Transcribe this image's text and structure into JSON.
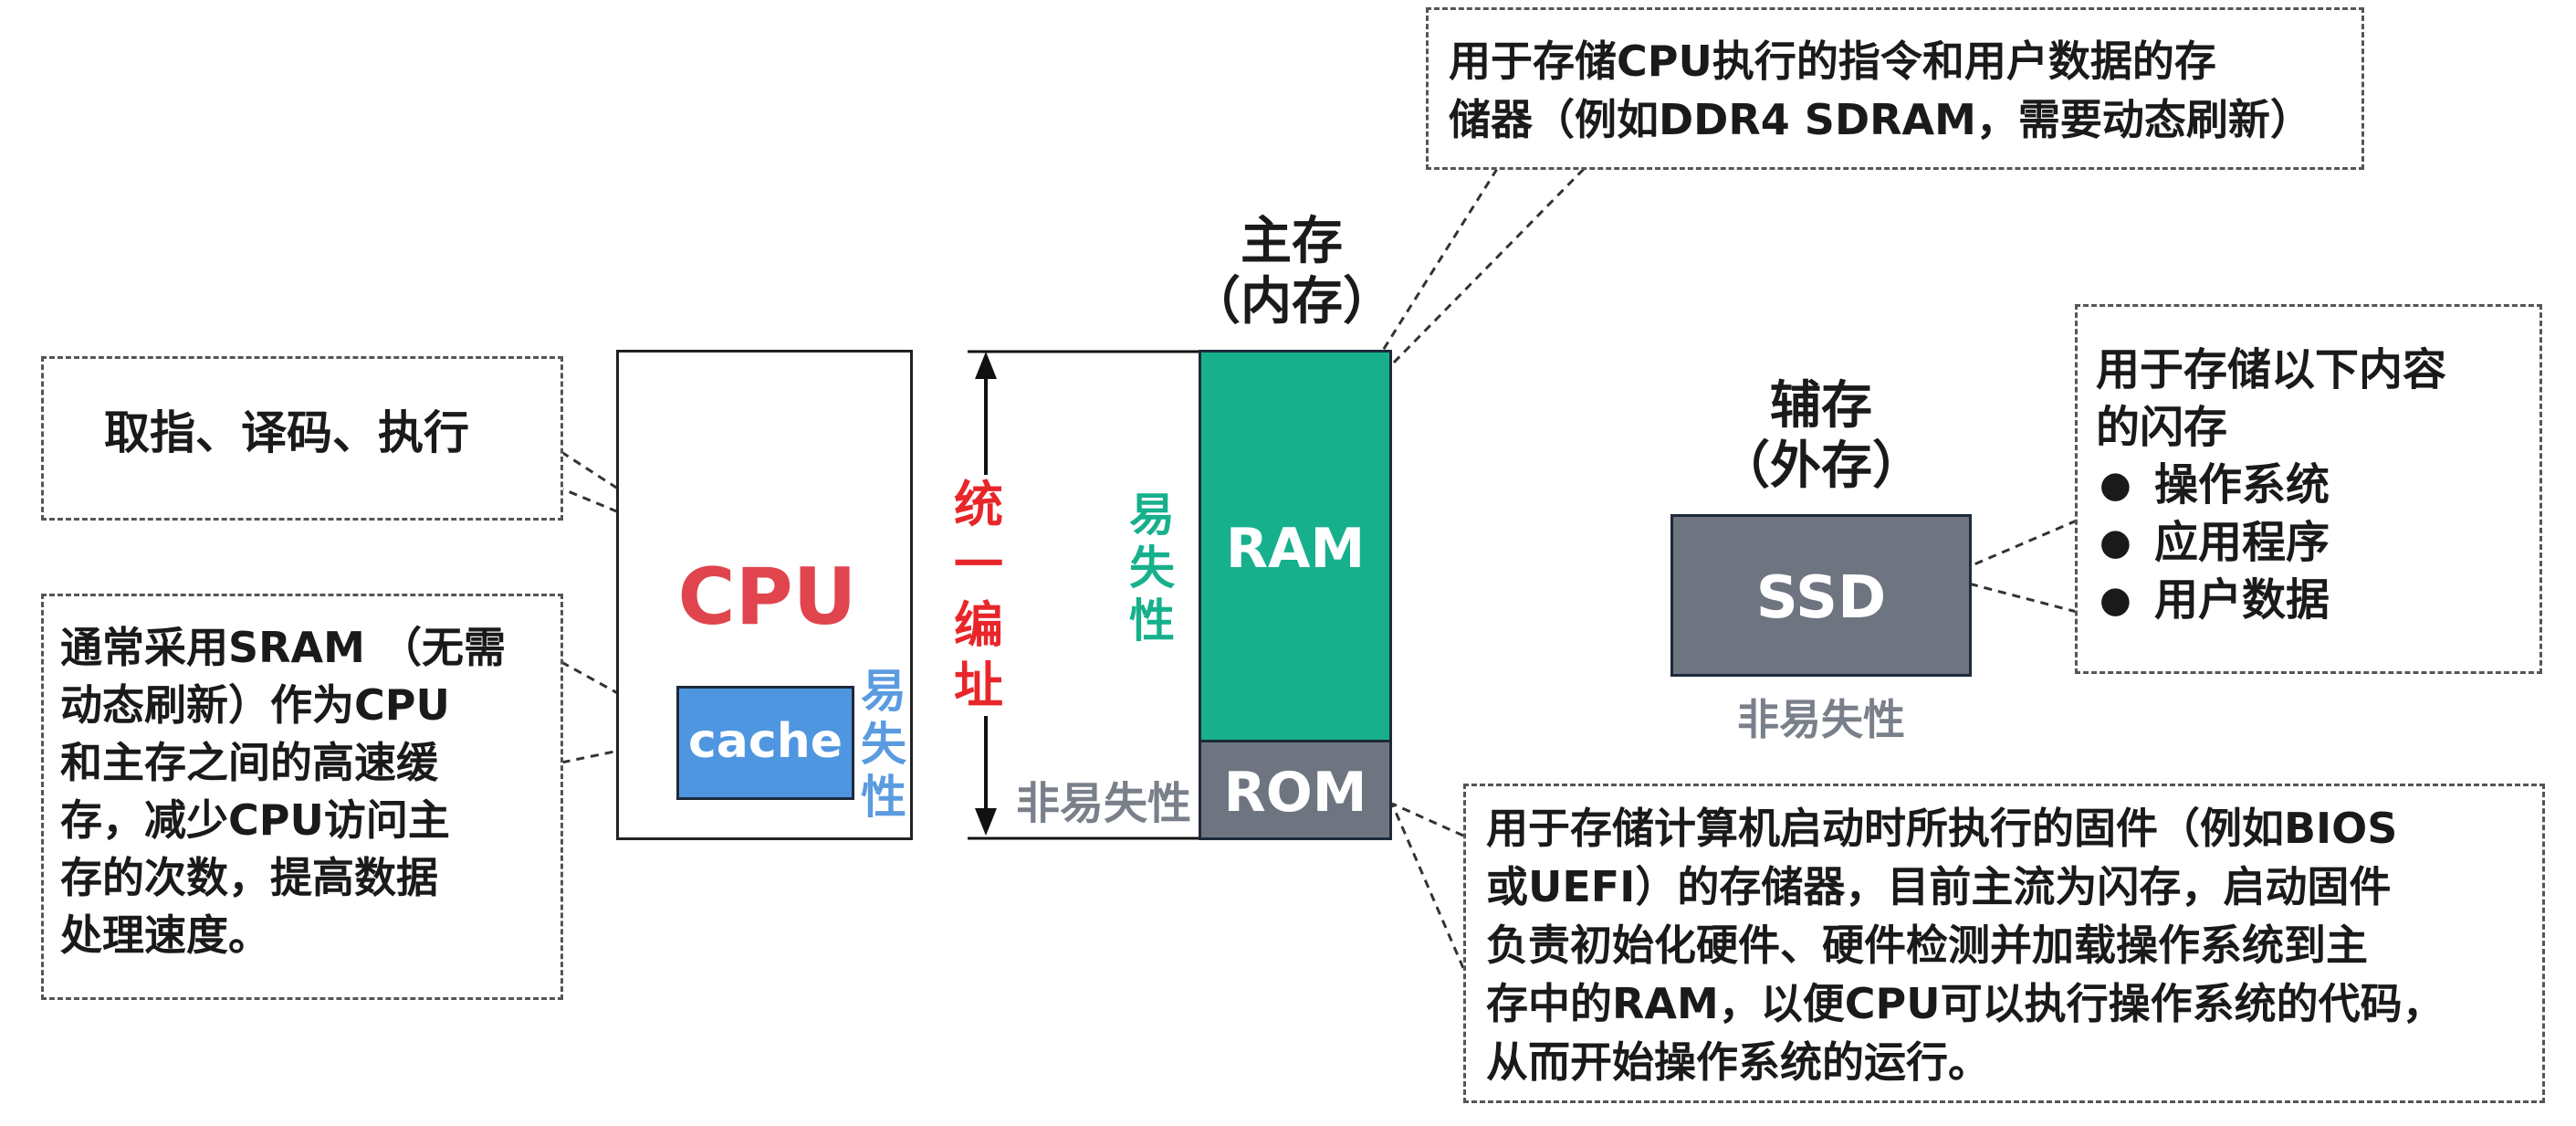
{
  "labels": {
    "cpu": "CPU",
    "cache": "cache",
    "cache_volatile": [
      "易",
      "失",
      "性"
    ],
    "unified_address": [
      "统",
      "一",
      "编",
      "址"
    ],
    "main_memory_title": "主存",
    "main_memory_subtitle": "（内存）",
    "ram": "RAM",
    "ram_volatile": [
      "易",
      "失",
      "性"
    ],
    "rom": "ROM",
    "rom_nonvolatile": "非易失性",
    "secondary_title": "辅存",
    "secondary_subtitle": "（外存）",
    "ssd": "SSD",
    "ssd_nonvolatile": "非易失性"
  },
  "notes": {
    "cpu_note": "取指、译码、执行",
    "cache_note": [
      "通常采用SRAM （无需",
      "动态刷新）作为CPU",
      "和主存之间的高速缓",
      "存，减少CPU访问主",
      "存的次数，提高数据",
      "处理速度。"
    ],
    "ram_note": [
      "用于存储CPU执行的指令和用户数据的存",
      "储器（例如DDR4 SDRAM，需要动态刷新）"
    ],
    "ssd_note_intro": [
      "用于存储以下内容",
      "的闪存"
    ],
    "ssd_note_items": [
      "操作系统",
      "应用程序",
      "用户数据"
    ],
    "rom_note": [
      "用于存储计算机启动时所执行的固件（例如BIOS",
      "或UEFI）的存储器，目前主流为闪存，启动固件",
      "负责初始化硬件、硬件检测并加载操作系统到主",
      "存中的RAM，以便CPU可以执行操作系统的代码，",
      "从而开始操作系统的运行。"
    ]
  },
  "colors": {
    "cpu_text": "#e0454e",
    "cache_fill": "#4f96e0",
    "cache_volatile_text": "#5b9be0",
    "unified_text": "#e8262a",
    "ram_fill": "#17b08d",
    "ram_volatile_text": "#17b08d",
    "rom_fill": "#6e7480",
    "ssd_fill": "#6e7480",
    "nonvolatile_text": "#7a808a"
  }
}
